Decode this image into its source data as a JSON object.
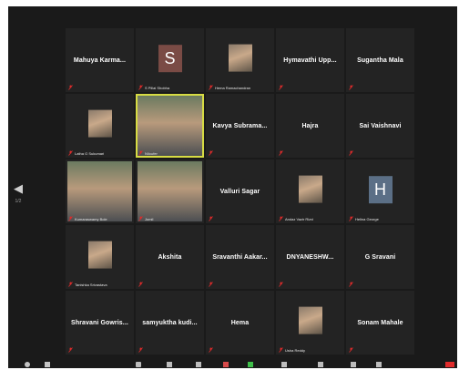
{
  "window": {
    "nav": {
      "prev_icon": "chevron-left-icon",
      "page_text": "1/2"
    }
  },
  "participants": [
    {
      "name": "Mahuya Karma...",
      "label": "",
      "type": "name"
    },
    {
      "name": "",
      "label": "S Pillai Shobha",
      "type": "letter",
      "letter": "S",
      "color": "#7a4b45"
    },
    {
      "name": "",
      "label": "Hema Ramachandran",
      "type": "photo"
    },
    {
      "name": "Hymavathi Upp...",
      "label": "",
      "type": "name"
    },
    {
      "name": "Sugantha Mala",
      "label": "",
      "type": "name"
    },
    {
      "name": "",
      "label": "Latha G Sukumari",
      "type": "photo"
    },
    {
      "name": "",
      "label": "Niloufer",
      "type": "video",
      "active": true
    },
    {
      "name": "Kavya Subrama...",
      "label": "",
      "type": "name"
    },
    {
      "name": "Hajra",
      "label": "",
      "type": "name"
    },
    {
      "name": "Sai Vaishnavi",
      "label": "",
      "type": "name"
    },
    {
      "name": "",
      "label": "Kumaraswamy Bole",
      "type": "video"
    },
    {
      "name": "",
      "label": "Jomil",
      "type": "video"
    },
    {
      "name": "Valluri Sagar",
      "label": "",
      "type": "name"
    },
    {
      "name": "",
      "label": "Andaz Vazir Rizvi",
      "type": "photo"
    },
    {
      "name": "",
      "label": "Helina George",
      "type": "letter",
      "letter": "H",
      "color": "#5b6f86"
    },
    {
      "name": "",
      "label": "Tanishka Srivastava",
      "type": "photo"
    },
    {
      "name": "Akshita",
      "label": "",
      "type": "name"
    },
    {
      "name": "Sravanthi Aakar...",
      "label": "",
      "type": "name"
    },
    {
      "name": "DNYANESHW...",
      "label": "",
      "type": "name"
    },
    {
      "name": "G Sravani",
      "label": "",
      "type": "name"
    },
    {
      "name": "Shravani Gowris...",
      "label": "",
      "type": "name"
    },
    {
      "name": "samyuktha kudi...",
      "label": "",
      "type": "name"
    },
    {
      "name": "Hema",
      "label": "",
      "type": "name"
    },
    {
      "name": "",
      "label": "Usha Reddy",
      "type": "photo"
    },
    {
      "name": "Sonam Mahale",
      "label": "",
      "type": "name"
    }
  ],
  "icons": {
    "muted": "muted-mic-icon"
  },
  "colors": {
    "background": "#1a1a1a",
    "tile": "#232323",
    "active_border": "#d7dc43",
    "mute_red": "#e02b2b"
  }
}
